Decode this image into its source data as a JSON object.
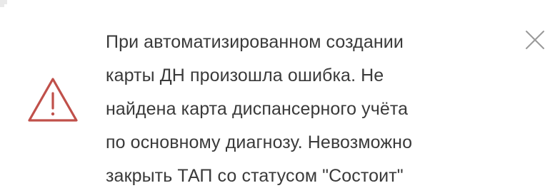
{
  "notification": {
    "message_lines": [
      "При автоматизированном создании",
      "карты ДН произошла ошибка. Не",
      "найдена карта диспансерного учёта",
      "по основному диагнозу. Невозможно",
      "закрыть ТАП со статусом \"Состоит\""
    ],
    "icon": "warning-triangle-icon",
    "close_icon": "close-icon",
    "colors": {
      "warning": "#c0504a",
      "text": "#3a3a3a",
      "close": "#9a9a9a"
    }
  }
}
